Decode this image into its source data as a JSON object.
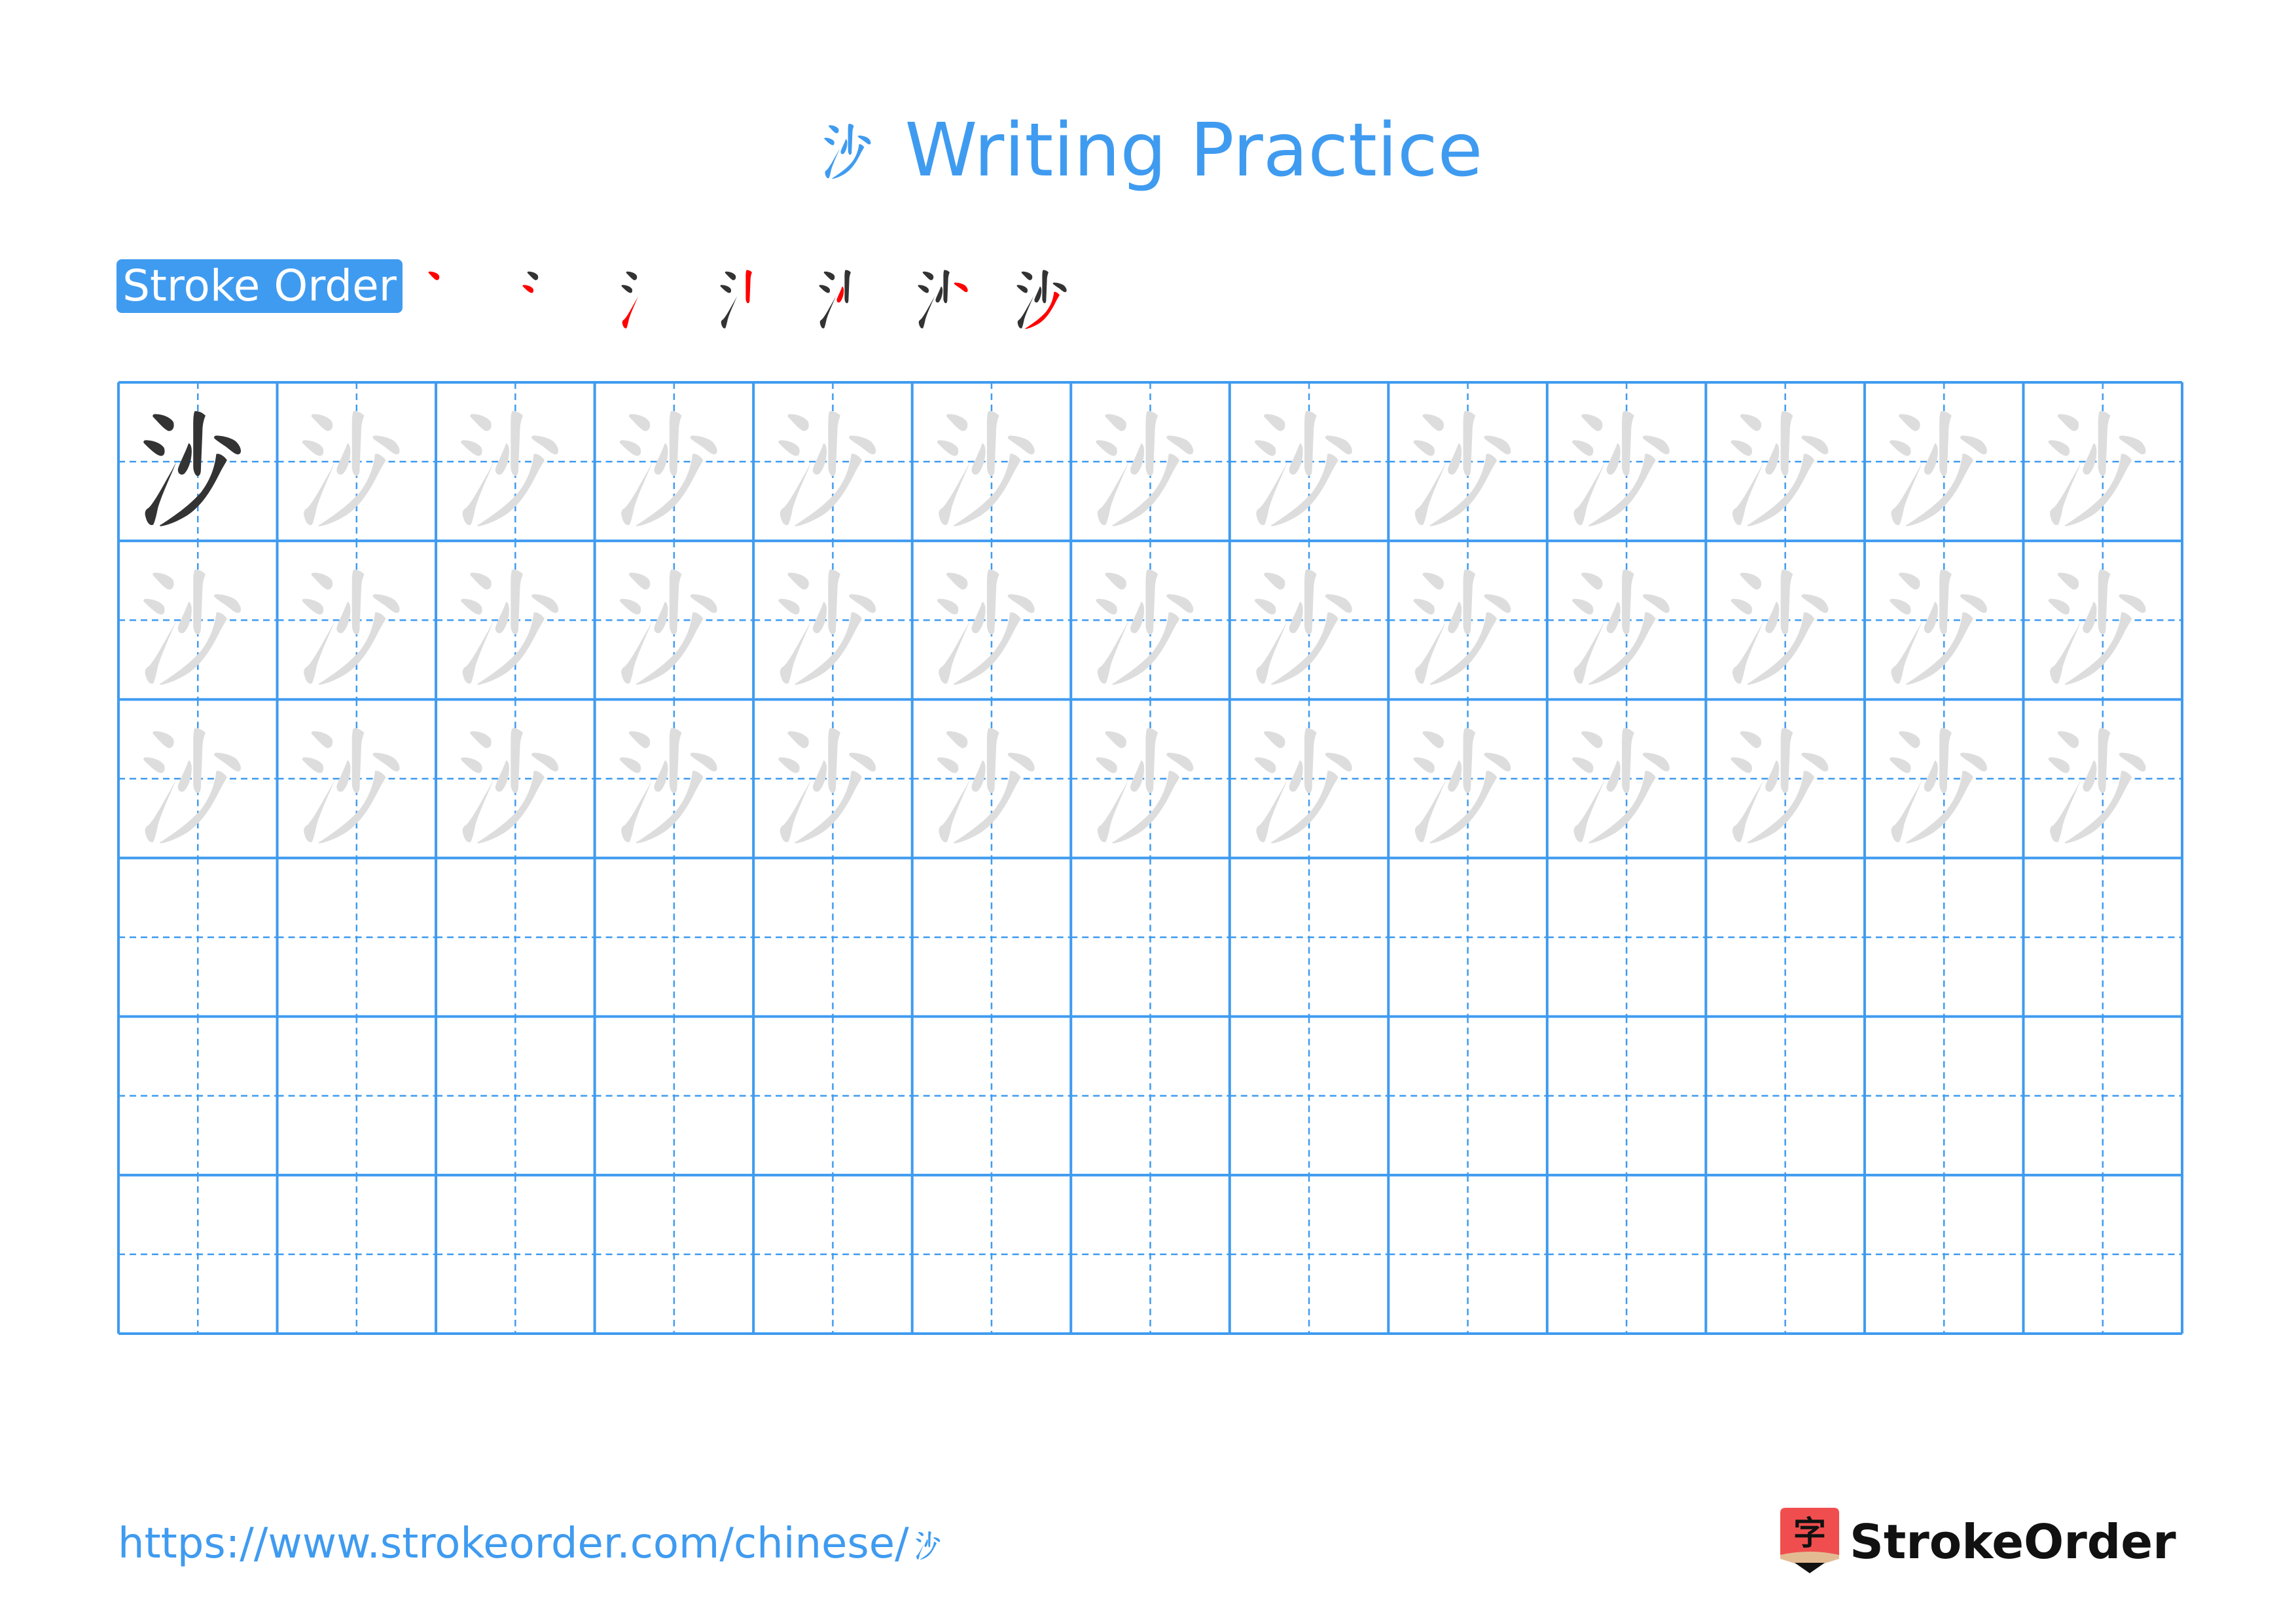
{
  "page": {
    "title": "沙 Writing Practice",
    "title_char": "沙",
    "title_suffix": "Writing Practice"
  },
  "stroke_order": {
    "badge_label": "Stroke Order",
    "total_strokes": 7,
    "steps": [
      1,
      2,
      3,
      4,
      5,
      6,
      7
    ]
  },
  "practice_grid": {
    "character": "沙",
    "columns": 13,
    "rows": 6,
    "row_types": [
      "model-then-trace",
      "trace",
      "trace",
      "empty",
      "empty",
      "empty"
    ]
  },
  "footer": {
    "url_prefix": "https://www.strokeorder.com/chinese/",
    "url_char": "沙",
    "brand_name": "StrokeOrder",
    "brand_icon_char": "字"
  },
  "colors": {
    "accent": "#3f9bf0",
    "stroke_current": "#ff0000",
    "stroke_done": "#333333",
    "trace_char": "#dddddd",
    "logo_red": "#f04e4e",
    "logo_tan": "#e3bb93"
  }
}
